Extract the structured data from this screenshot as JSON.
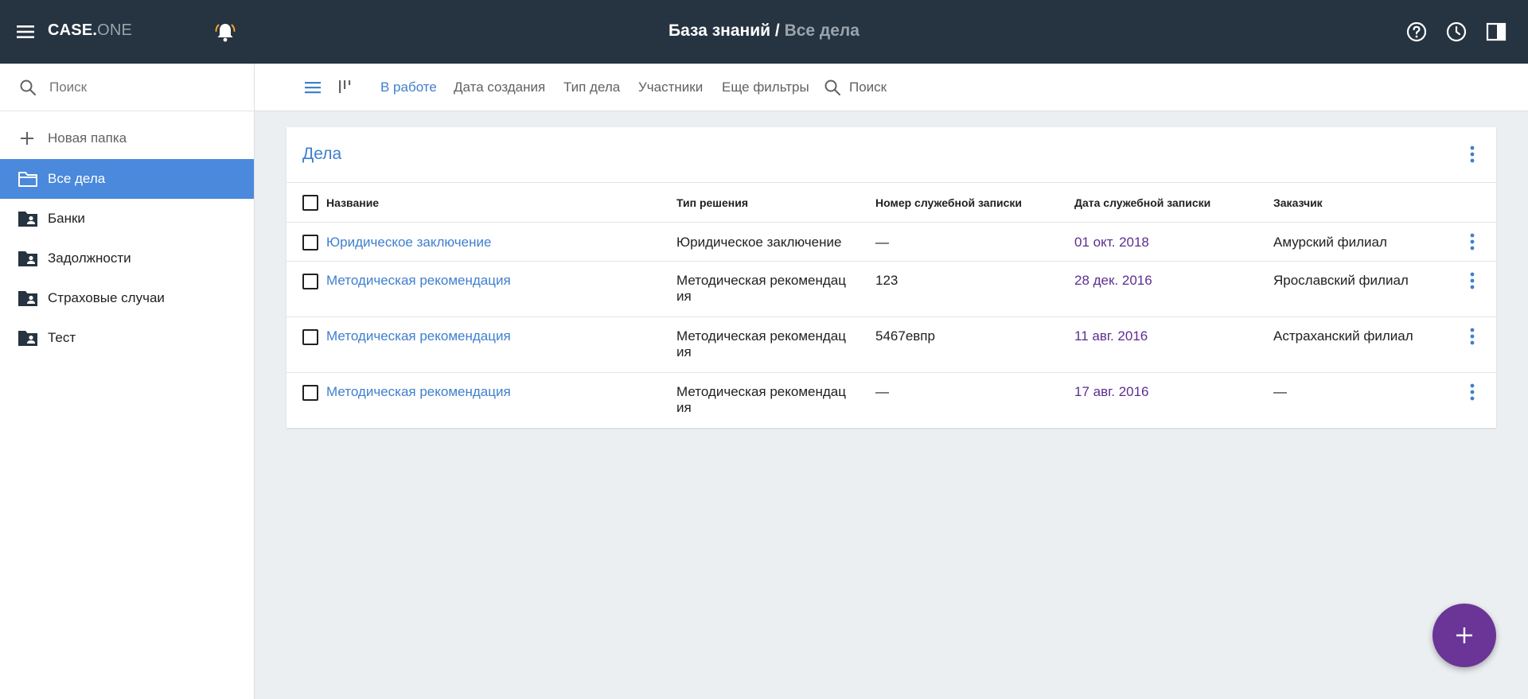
{
  "app": {
    "logo_primary": "CASE.",
    "logo_secondary": "ONE"
  },
  "header": {
    "breadcrumb_root": "База знаний",
    "breadcrumb_separator": " / ",
    "breadcrumb_current": "Все дела"
  },
  "sidebar": {
    "search_placeholder": "Поиск",
    "new_folder_label": "Новая папка",
    "items": [
      {
        "label": "Все дела",
        "icon": "folder-outline-icon",
        "active": true
      },
      {
        "label": "Банки",
        "icon": "shared-folder-icon"
      },
      {
        "label": "Задолжности",
        "icon": "shared-folder-icon"
      },
      {
        "label": "Страховые случаи",
        "icon": "shared-folder-icon"
      },
      {
        "label": "Тест",
        "icon": "shared-folder-icon"
      }
    ]
  },
  "filters": {
    "items": [
      {
        "label": "В работе",
        "active": true
      },
      {
        "label": "Дата создания"
      },
      {
        "label": "Тип дела"
      },
      {
        "label": "Участники"
      },
      {
        "label": "Еще фильтры"
      }
    ],
    "search_placeholder": "Поиск"
  },
  "card": {
    "title": "Дела",
    "columns": [
      "Название",
      "Тип решения",
      "Номер служебной записки",
      "Дата служебной записки",
      "Заказчик"
    ],
    "rows": [
      {
        "name": "Юридическое заключение",
        "decision_type": "Юридическое заключение",
        "memo_number": "—",
        "memo_date": "01 окт. 2018",
        "customer": "Амурский филиал"
      },
      {
        "name": "Методическая рекомендация",
        "decision_type": "Методическая рекомендация",
        "memo_number": "123",
        "memo_date": "28 дек. 2016",
        "customer": "Ярославский филиал"
      },
      {
        "name": "Методическая рекомендация",
        "decision_type": "Методическая рекомендация",
        "memo_number": "5467евпр",
        "memo_date": "11 авг. 2016",
        "customer": "Астраханский филиал"
      },
      {
        "name": "Методическая рекомендация",
        "decision_type": "Методическая рекомендация",
        "memo_number": "—",
        "memo_date": "17 авг. 2016",
        "customer": "—"
      }
    ]
  },
  "colors": {
    "header_bg": "#263340",
    "accent_blue": "#4a89dc",
    "link_blue": "#3f7fce",
    "date_purple": "#5e2d91",
    "fab_purple": "#6a3596",
    "bell_orange": "#f5a623"
  },
  "icons": {
    "menu": "menu-icon",
    "bell": "bell-icon",
    "help": "help-icon",
    "history": "clock-icon",
    "panel": "side-panel-icon",
    "fab": "plus-icon"
  }
}
